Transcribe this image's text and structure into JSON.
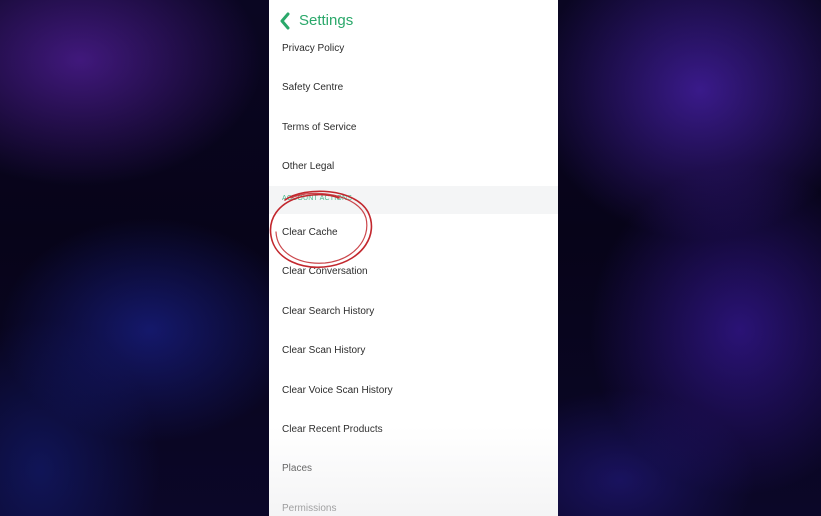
{
  "header": {
    "title": "Settings",
    "back_icon": "chevron-left-icon"
  },
  "colors": {
    "accent": "#2aa86a",
    "section_label": "#46b88a",
    "annotation": "#c2272d"
  },
  "rows_top": [
    {
      "label": "Privacy Policy"
    },
    {
      "label": "Safety Centre"
    },
    {
      "label": "Terms of Service"
    },
    {
      "label": "Other Legal"
    }
  ],
  "section": {
    "label": "ACCOUNT ACTIONS"
  },
  "rows_bottom": [
    {
      "label": "Clear Cache"
    },
    {
      "label": "Clear Conversation"
    },
    {
      "label": "Clear Search History"
    },
    {
      "label": "Clear Scan History"
    },
    {
      "label": "Clear Voice Scan History"
    },
    {
      "label": "Clear Recent Products"
    },
    {
      "label": "Places"
    },
    {
      "label": "Permissions"
    }
  ]
}
